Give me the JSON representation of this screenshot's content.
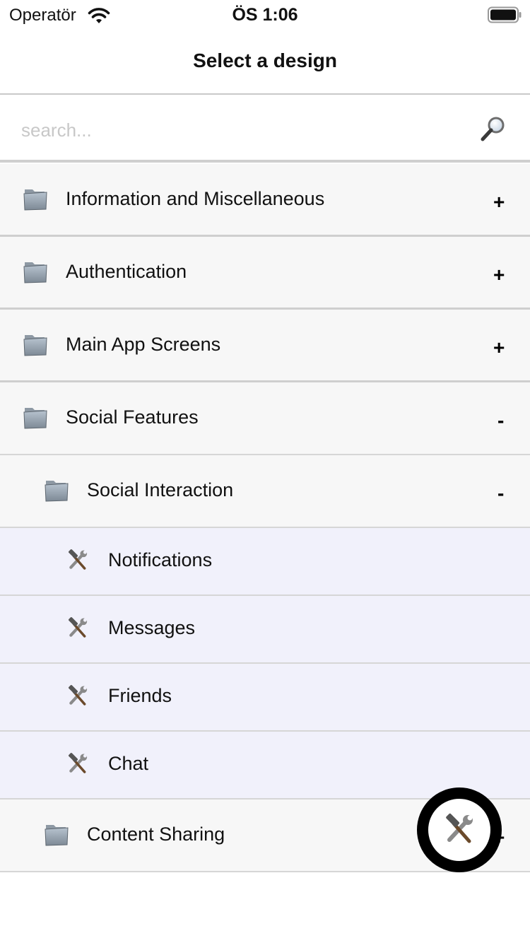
{
  "status_bar": {
    "carrier": "Operatör",
    "time": "ÖS 1:06",
    "wifi_icon": "wifi-icon",
    "battery_icon": "battery-icon"
  },
  "nav": {
    "title": "Select a design"
  },
  "search": {
    "placeholder": "search...",
    "value": "",
    "icon": "search-icon"
  },
  "list": {
    "rows": [
      {
        "kind": "folder",
        "label": "Information and Miscellaneous",
        "toggle": "+",
        "level": 0,
        "icon": "folder-icon"
      },
      {
        "kind": "folder",
        "label": "Authentication",
        "toggle": "+",
        "level": 0,
        "icon": "folder-icon"
      },
      {
        "kind": "folder",
        "label": "Main App Screens",
        "toggle": "+",
        "level": 0,
        "icon": "folder-icon"
      },
      {
        "kind": "folder",
        "label": "Social Features",
        "toggle": "-",
        "level": 0,
        "icon": "folder-icon"
      },
      {
        "kind": "folder",
        "label": "Social Interaction",
        "toggle": "-",
        "level": 1,
        "icon": "folder-icon"
      },
      {
        "kind": "item",
        "label": "Notifications",
        "level": 2,
        "icon": "hammer-wrench-icon"
      },
      {
        "kind": "item",
        "label": "Messages",
        "level": 2,
        "icon": "hammer-wrench-icon"
      },
      {
        "kind": "item",
        "label": "Friends",
        "level": 2,
        "icon": "hammer-wrench-icon"
      },
      {
        "kind": "item",
        "label": "Chat",
        "level": 2,
        "icon": "hammer-wrench-icon"
      },
      {
        "kind": "folder",
        "label": "Content Sharing",
        "toggle": "+",
        "level": 1,
        "icon": "folder-icon"
      }
    ]
  },
  "fab": {
    "icon": "hammer-wrench-icon"
  }
}
